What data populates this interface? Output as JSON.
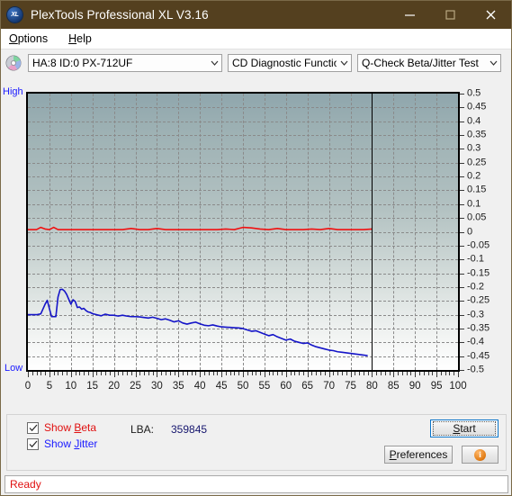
{
  "window": {
    "title": "PlexTools Professional XL V3.16",
    "icon": "xl-app-icon",
    "minimize_label": "—",
    "maximize_label": "□",
    "close_label": "✕",
    "titlebar_color": "#54401f"
  },
  "menubar": {
    "items": [
      {
        "label": "Options",
        "accel": "O"
      },
      {
        "label": "Help",
        "accel": "H"
      }
    ]
  },
  "toolbar": {
    "drive_icon": "cd-disc-icon",
    "drive_select": {
      "value": "HA:8 ID:0  PX-712UF"
    },
    "function_select": {
      "value": "CD Diagnostic Functions"
    },
    "test_select": {
      "value": "Q-Check Beta/Jitter Test"
    }
  },
  "chart_axis": {
    "high_label": "High",
    "low_label": "Low"
  },
  "controls": {
    "show_beta": {
      "label_pre": "Show ",
      "label_accel": "B",
      "label_post": "eta",
      "checked": true,
      "color": "#e01010"
    },
    "show_jitter": {
      "label_pre": "Show ",
      "label_accel": "J",
      "label_post": "itter",
      "checked": true,
      "color": "#1a1aff"
    },
    "lba_label": "LBA:",
    "lba_value": "359845",
    "start_button": {
      "pre": "",
      "accel": "S",
      "post": "tart"
    },
    "preferences_button": {
      "pre": "",
      "accel": "P",
      "post": "references"
    },
    "info_button": {
      "glyph": "i"
    }
  },
  "statusbar": {
    "text": "Ready"
  },
  "chart_data": {
    "type": "line",
    "title": "Q-Check Beta/Jitter Test",
    "xlabel": "",
    "ylabel": "",
    "xlim": [
      0,
      100
    ],
    "ylim": [
      -0.5,
      0.5
    ],
    "grid": true,
    "legend": "none",
    "left_axis_labels": [
      "High",
      "Low"
    ],
    "x_ticks": [
      0,
      5,
      10,
      15,
      20,
      25,
      30,
      35,
      40,
      45,
      50,
      55,
      60,
      65,
      70,
      75,
      80,
      85,
      90,
      95,
      100
    ],
    "y_ticks": [
      0.5,
      0.45,
      0.4,
      0.35,
      0.3,
      0.25,
      0.2,
      0.15,
      0.1,
      0.05,
      0,
      -0.05,
      -0.1,
      -0.15,
      -0.2,
      -0.25,
      -0.3,
      -0.35,
      -0.4,
      -0.45,
      -0.5
    ],
    "annotations": [
      {
        "type": "vline",
        "x": 80,
        "color": "#000000",
        "label": "test-end-marker"
      }
    ],
    "series": [
      {
        "name": "Beta",
        "color": "#f01010",
        "x": [
          0,
          2,
          3,
          4,
          5,
          6,
          7,
          8,
          10,
          12,
          14,
          16,
          18,
          20,
          22,
          24,
          26,
          28,
          30,
          32,
          34,
          36,
          38,
          40,
          42,
          44,
          46,
          48,
          50,
          52,
          54,
          56,
          58,
          60,
          62,
          64,
          66,
          68,
          70,
          72,
          74,
          76,
          78,
          80
        ],
        "values": [
          0.008,
          0.008,
          0.016,
          0.01,
          0.008,
          0.016,
          0.008,
          0.008,
          0.008,
          0.008,
          0.008,
          0.008,
          0.008,
          0.008,
          0.008,
          0.012,
          0.008,
          0.008,
          0.012,
          0.008,
          0.008,
          0.008,
          0.008,
          0.008,
          0.008,
          0.008,
          0.01,
          0.008,
          0.016,
          0.014,
          0.01,
          0.008,
          0.012,
          0.008,
          0.008,
          0.008,
          0.01,
          0.008,
          0.012,
          0.008,
          0.008,
          0.008,
          0.008,
          0.01
        ]
      },
      {
        "name": "Jitter",
        "color": "#1414c8",
        "x": [
          0,
          1,
          2,
          3,
          4,
          4.5,
          5,
          5.5,
          6,
          6.5,
          7,
          7.5,
          8,
          8.5,
          9,
          9.5,
          10,
          10.5,
          11,
          11.5,
          12,
          12.5,
          13,
          13.5,
          14,
          14.5,
          15,
          16,
          17,
          18,
          19,
          20,
          21,
          22,
          23,
          24,
          25,
          26,
          27,
          28,
          29,
          30,
          31,
          32,
          33,
          34,
          35,
          36,
          37,
          38,
          39,
          40,
          41,
          42,
          43,
          44,
          45,
          46,
          47,
          48,
          49,
          50,
          51,
          52,
          53,
          54,
          55,
          56,
          57,
          58,
          59,
          60,
          61,
          62,
          63,
          64,
          65,
          66,
          67,
          68,
          69,
          70,
          71,
          72,
          73,
          74,
          75,
          76,
          77,
          78,
          79,
          80
        ],
        "values": [
          -0.3,
          -0.3,
          -0.3,
          -0.297,
          -0.262,
          -0.248,
          -0.278,
          -0.307,
          -0.307,
          -0.307,
          -0.236,
          -0.209,
          -0.208,
          -0.214,
          -0.226,
          -0.244,
          -0.262,
          -0.246,
          -0.252,
          -0.274,
          -0.272,
          -0.28,
          -0.277,
          -0.285,
          -0.29,
          -0.292,
          -0.296,
          -0.3,
          -0.304,
          -0.298,
          -0.302,
          -0.302,
          -0.305,
          -0.302,
          -0.305,
          -0.307,
          -0.307,
          -0.308,
          -0.31,
          -0.312,
          -0.309,
          -0.313,
          -0.318,
          -0.315,
          -0.32,
          -0.326,
          -0.322,
          -0.33,
          -0.334,
          -0.33,
          -0.327,
          -0.333,
          -0.338,
          -0.34,
          -0.337,
          -0.341,
          -0.344,
          -0.345,
          -0.346,
          -0.347,
          -0.348,
          -0.35,
          -0.355,
          -0.36,
          -0.358,
          -0.364,
          -0.37,
          -0.376,
          -0.372,
          -0.38,
          -0.386,
          -0.392,
          -0.388,
          -0.396,
          -0.4,
          -0.404,
          -0.402,
          -0.41,
          -0.416,
          -0.42,
          -0.424,
          -0.428,
          -0.43,
          -0.434,
          -0.436,
          -0.438,
          -0.44,
          -0.442,
          -0.444,
          -0.446,
          -0.448
        ]
      }
    ]
  }
}
